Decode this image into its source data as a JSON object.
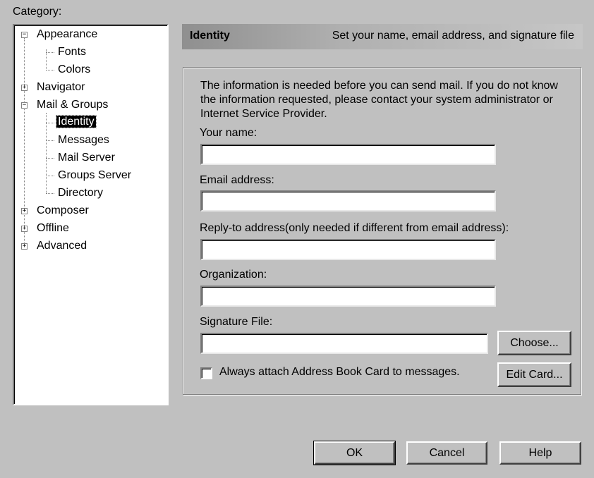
{
  "category_label": "Category:",
  "tree": {
    "appearance": "Appearance",
    "fonts": "Fonts",
    "colors": "Colors",
    "navigator": "Navigator",
    "mail_groups": "Mail & Groups",
    "identity": "Identity",
    "messages": "Messages",
    "mail_server": "Mail Server",
    "groups_server": "Groups Server",
    "directory": "Directory",
    "composer": "Composer",
    "offline": "Offline",
    "advanced": "Advanced"
  },
  "header": {
    "title": "Identity",
    "description": "Set your name, email address, and signature file"
  },
  "info_text": "The information is needed before you can send mail.  If you do not know the information requested, please contact your system administrator or Internet Service Provider.",
  "fields": {
    "your_name_label": "Your name:",
    "your_name_value": "",
    "email_label": "Email address:",
    "email_value": "",
    "reply_to_label": "Reply-to address(only needed if different from email address):",
    "reply_to_value": "",
    "organization_label": "Organization:",
    "organization_value": "",
    "signature_label": "Signature File:",
    "signature_value": ""
  },
  "buttons": {
    "choose": "Choose...",
    "edit_card": "Edit Card...",
    "ok": "OK",
    "cancel": "Cancel",
    "help": "Help"
  },
  "checkbox": {
    "label": "Always attach Address Book Card to messages.",
    "checked": false
  }
}
